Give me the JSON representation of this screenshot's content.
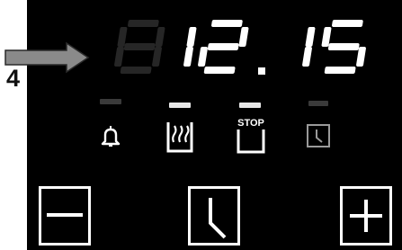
{
  "callout": {
    "number": "4",
    "arrow_icon": "right-arrow-icon",
    "arrow_color": "#8a8a8a"
  },
  "display": {
    "time": "12.15",
    "hours": "12",
    "minutes": "15",
    "inactive_digit": "8",
    "lit_color": "#ffffff",
    "dim_color": "#262626"
  },
  "mode_icons": [
    {
      "name": "bell-icon",
      "active": false
    },
    {
      "name": "cooking-heat-icon",
      "active": true
    },
    {
      "name": "stop-icon",
      "label": "STOP",
      "active": true
    },
    {
      "name": "clock-icon",
      "active": false
    }
  ],
  "keys": [
    {
      "name": "minus-button",
      "icon": "minus-icon"
    },
    {
      "name": "clock-button",
      "icon": "clock-icon"
    },
    {
      "name": "plus-button",
      "icon": "plus-icon"
    }
  ],
  "colors": {
    "panel": "#000000",
    "indicator_on": "#e8e8e8",
    "indicator_off": "#3a3a3a",
    "icon_active": "#ffffff",
    "icon_inactive": "#9a9a9a"
  }
}
